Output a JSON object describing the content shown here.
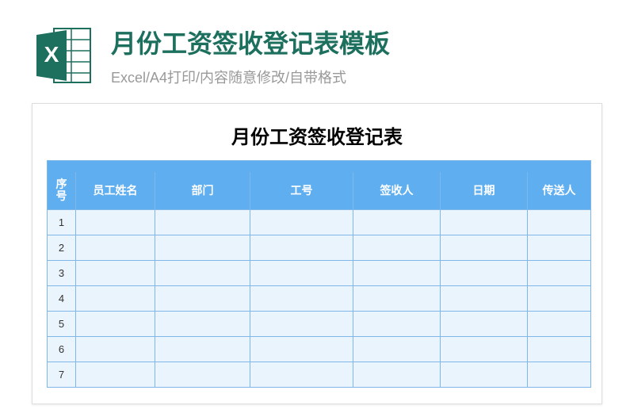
{
  "header": {
    "title": "月份工资签收登记表模板",
    "subtitle": "Excel/A4打印/内容随意修改/自带格式"
  },
  "sheet": {
    "title": "月份工资签收登记表",
    "columns": {
      "seq": "序号",
      "name": "员工姓名",
      "dept": "部门",
      "emp_id": "工号",
      "signer": "签收人",
      "date": "日期",
      "sender": "传送人"
    },
    "rows": [
      {
        "seq": "1",
        "name": "",
        "dept": "",
        "emp_id": "",
        "signer": "",
        "date": "",
        "sender": ""
      },
      {
        "seq": "2",
        "name": "",
        "dept": "",
        "emp_id": "",
        "signer": "",
        "date": "",
        "sender": ""
      },
      {
        "seq": "3",
        "name": "",
        "dept": "",
        "emp_id": "",
        "signer": "",
        "date": "",
        "sender": ""
      },
      {
        "seq": "4",
        "name": "",
        "dept": "",
        "emp_id": "",
        "signer": "",
        "date": "",
        "sender": ""
      },
      {
        "seq": "5",
        "name": "",
        "dept": "",
        "emp_id": "",
        "signer": "",
        "date": "",
        "sender": ""
      },
      {
        "seq": "6",
        "name": "",
        "dept": "",
        "emp_id": "",
        "signer": "",
        "date": "",
        "sender": ""
      },
      {
        "seq": "7",
        "name": "",
        "dept": "",
        "emp_id": "",
        "signer": "",
        "date": "",
        "sender": ""
      }
    ]
  }
}
